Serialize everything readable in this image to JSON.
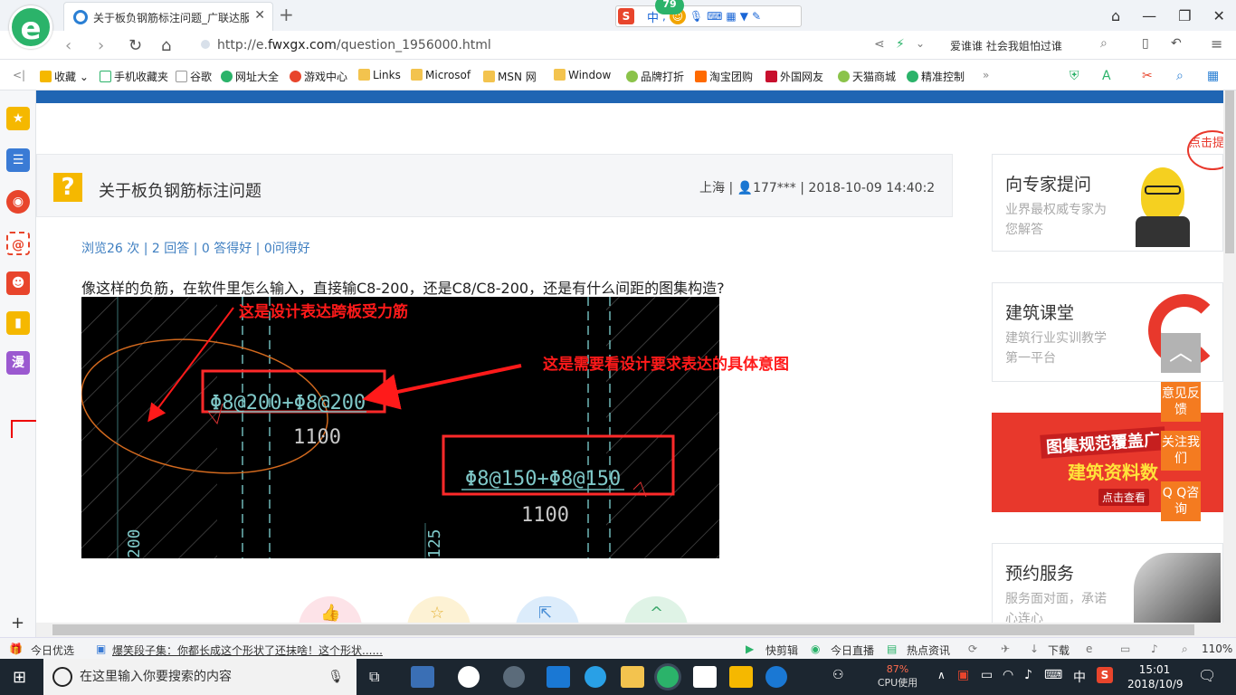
{
  "browser": {
    "tab_title": "关于板负钢筋标注问题_广联达服",
    "sogou_badge": "79",
    "sogou_mode": "中",
    "url_prefix": "http://e.",
    "url_domain": "fwxgx.com",
    "url_path": "/question_1956000.html",
    "search_hint": "爱谁谁 社会我姐怕过谁"
  },
  "favorites": [
    "收藏",
    "手机收藏夹",
    "谷歌",
    "网址大全",
    "游戏中心",
    "Links",
    "Microsof",
    "MSN 网",
    "Window",
    "品牌打折",
    "淘宝团购",
    "外国网友",
    "天猫商城",
    "精准控制"
  ],
  "question": {
    "title": "关于板负钢筋标注问题",
    "location": "上海",
    "user": "177***",
    "datetime": "2018-10-09 14:40:2",
    "stats": "浏览26 次 | 2 回答 | 0 答得好 | 0问得好",
    "body": "像这样的负筋，在软件里怎么输入，直接输C8-200，还是C8/C8-200，还是有什么间距的图集构造?"
  },
  "drawing": {
    "note_top": "这是设计表达跨板受力筋",
    "note_right": "这是需要看设计要求表达的具体意图",
    "label_a": "Φ8@200+Φ8@200",
    "dim_a": "1100",
    "label_b": "Φ8@150+Φ8@150",
    "dim_b": "1100",
    "side_a": "200",
    "side_b": "125"
  },
  "sidebar_right": {
    "expert_title": "向专家提问",
    "expert_sub": "业界最权威专家为您解答",
    "course_title": "建筑课堂",
    "course_sub": "建筑行业实训教学第一平台",
    "banner_line1": "图集规范覆盖广",
    "banner_line2": "建筑资料数",
    "banner_btn": "点击查看",
    "booking_title": "预约服务",
    "booking_sub": "服务面对面，承诺心连心",
    "ask_bubble": "点击提问"
  },
  "float_buttons": {
    "feedback": "意见反馈",
    "follow": "关注我们",
    "qq": "Q Q咨询"
  },
  "statusbar": {
    "today": "今日优选",
    "news": "爆笑段子集：你都长成这个形状了还抹啥！这个形状......",
    "quick": "快剪辑",
    "live": "今日直播",
    "hot": "热点资讯",
    "download": "下载",
    "zoom": "110%"
  },
  "taskbar": {
    "search_placeholder": "在这里输入你要搜索的内容",
    "cpu_value": "87%",
    "cpu_label": "CPU使用",
    "ime": "中",
    "time": "15:01",
    "date": "2018/10/9"
  },
  "colors": {
    "accent_blue": "#1f65b3",
    "orange": "#f47b20",
    "annotation_red": "#ff1a1a"
  }
}
